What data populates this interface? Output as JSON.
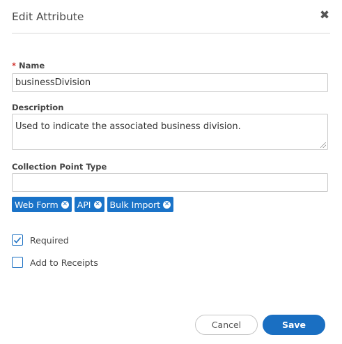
{
  "dialog": {
    "title": "Edit Attribute",
    "close_icon": "close-icon"
  },
  "form": {
    "name": {
      "required_marker": "*",
      "label": "Name",
      "value": "businessDivision"
    },
    "description": {
      "label": "Description",
      "value": "Used to indicate the associated business division."
    },
    "collection_point_type": {
      "label": "Collection Point Type",
      "value": "",
      "tags": [
        {
          "label": "Web Form",
          "remove_icon": "remove-circle-icon"
        },
        {
          "label": "API",
          "remove_icon": "remove-circle-icon"
        },
        {
          "label": "Bulk Import",
          "remove_icon": "remove-circle-icon"
        }
      ],
      "tag_color": "#1a73c8"
    },
    "required": {
      "label": "Required",
      "checked": true
    },
    "add_to_receipts": {
      "label": "Add to Receipts",
      "checked": false
    }
  },
  "footer": {
    "cancel_label": "Cancel",
    "save_label": "Save",
    "primary_color": "#1a6fc2"
  }
}
